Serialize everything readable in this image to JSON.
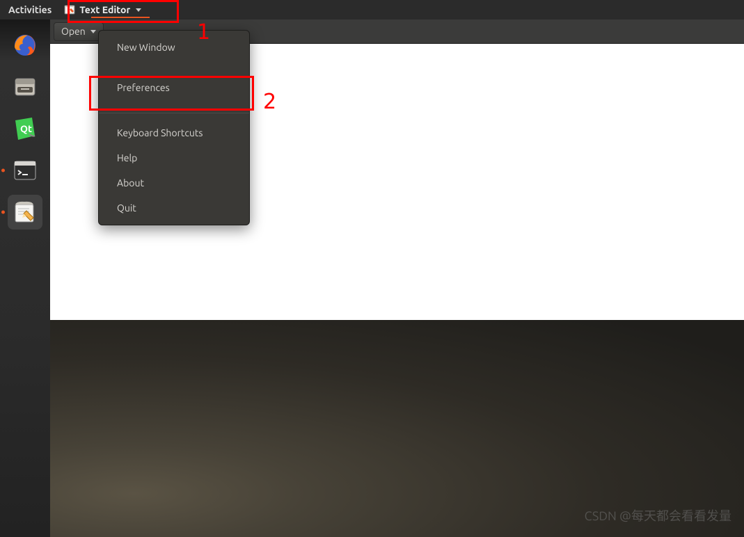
{
  "topbar": {
    "activities": "Activities",
    "app_name": "Text Editor"
  },
  "dock": {
    "items": [
      {
        "name": "firefox",
        "active": false
      },
      {
        "name": "files",
        "active": false
      },
      {
        "name": "qt-creator",
        "active": false
      },
      {
        "name": "terminal",
        "active": true
      },
      {
        "name": "text-editor",
        "active": true
      }
    ]
  },
  "toolbar": {
    "open_label": "Open"
  },
  "menu": {
    "items": [
      "New Window",
      "Preferences",
      "Keyboard Shortcuts",
      "Help",
      "About",
      "Quit"
    ]
  },
  "annotations": {
    "label1": "1",
    "label2": "2"
  },
  "watermark": "CSDN @每天都会看看发量"
}
